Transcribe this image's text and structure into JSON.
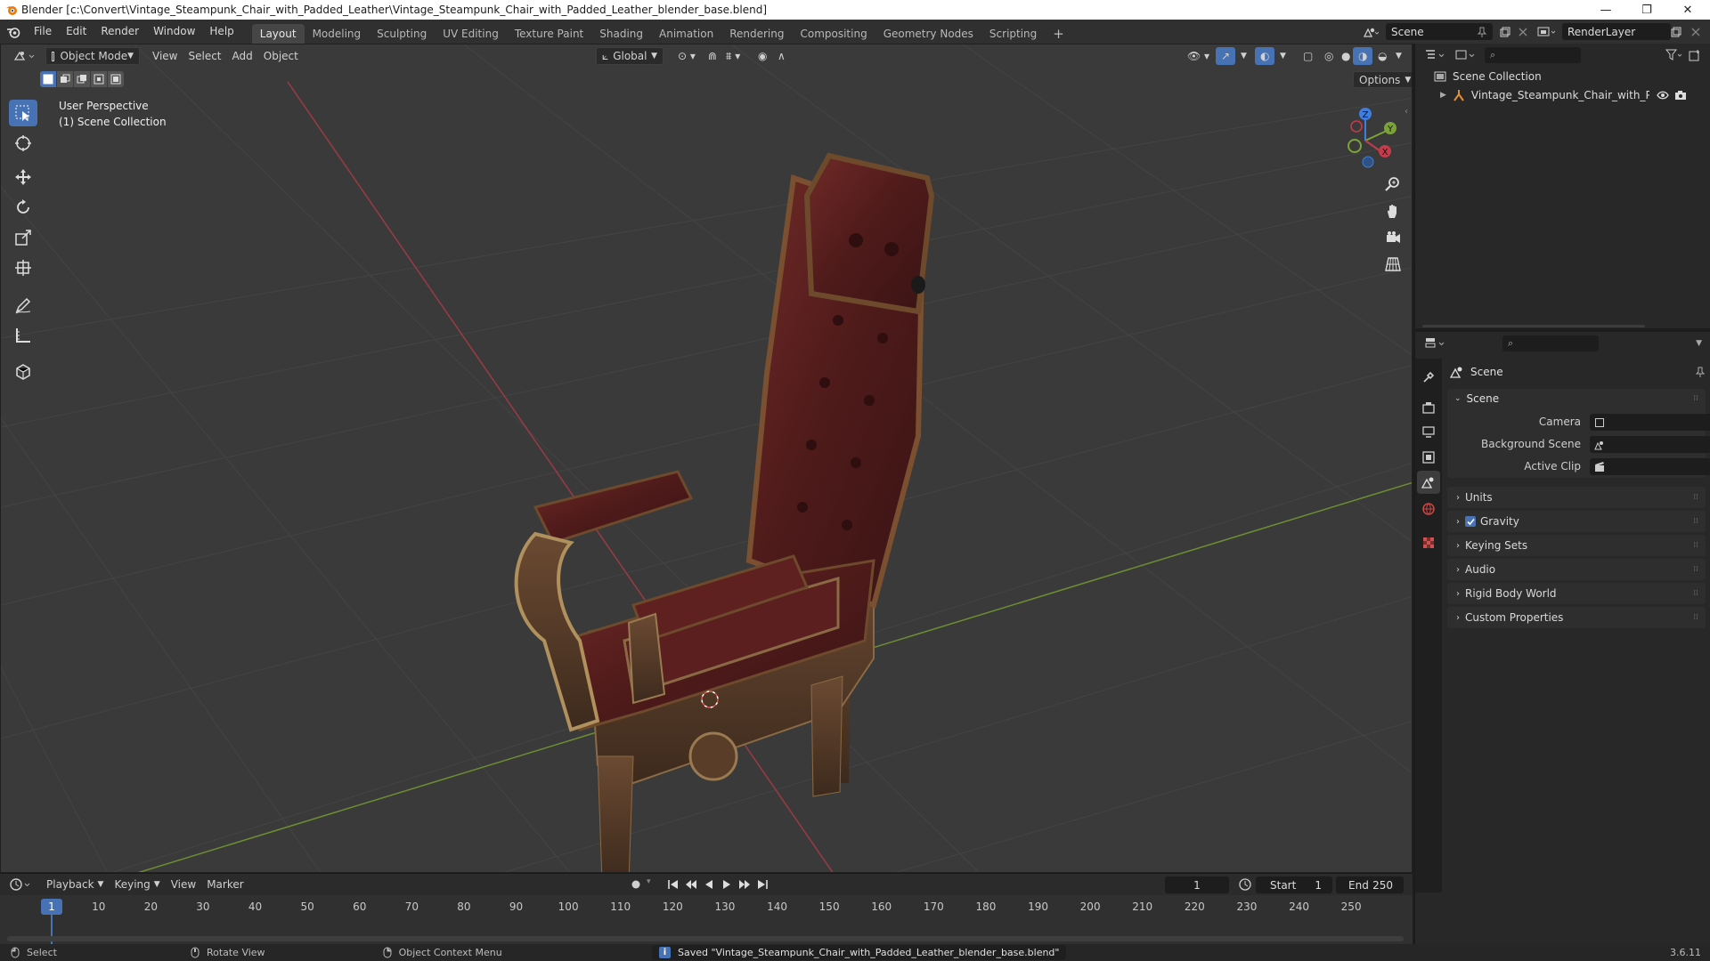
{
  "window": {
    "title": "Blender [c:\\Convert\\Vintage_Steampunk_Chair_with_Padded_Leather\\Vintage_Steampunk_Chair_with_Padded_Leather_blender_base.blend]",
    "minimize": "—",
    "maximize": "❐",
    "close": "✕"
  },
  "menu": [
    "File",
    "Edit",
    "Render",
    "Window",
    "Help"
  ],
  "workspaces": {
    "tabs": [
      "Layout",
      "Modeling",
      "Sculpting",
      "UV Editing",
      "Texture Paint",
      "Shading",
      "Animation",
      "Rendering",
      "Compositing",
      "Geometry Nodes",
      "Scripting"
    ],
    "active": "Layout",
    "add": "+"
  },
  "scene_selector": {
    "value": "Scene"
  },
  "view_layer_selector": {
    "value": "RenderLayer"
  },
  "viewport": {
    "mode": "Object Mode",
    "menus": [
      "View",
      "Select",
      "Add",
      "Object"
    ],
    "orientation": "Global",
    "options": "Options",
    "overlay_text": {
      "perspective": "User Perspective",
      "collection": "(1) Scene Collection"
    },
    "gizmo_axes": {
      "x": "X",
      "y": "Y",
      "z": "Z"
    }
  },
  "outliner": {
    "search_placeholder": "",
    "root": "Scene Collection",
    "items": [
      {
        "label": "Vintage_Steampunk_Chair_with_Paddec"
      }
    ]
  },
  "properties": {
    "header": "Scene",
    "scene_panel": {
      "title": "Scene",
      "fields": [
        {
          "label": "Camera",
          "value": ""
        },
        {
          "label": "Background Scene",
          "value": ""
        },
        {
          "label": "Active Clip",
          "value": ""
        }
      ]
    },
    "panels": [
      {
        "label": "Units",
        "checkbox": false
      },
      {
        "label": "Gravity",
        "checkbox": true
      },
      {
        "label": "Keying Sets",
        "checkbox": false
      },
      {
        "label": "Audio",
        "checkbox": false
      },
      {
        "label": "Rigid Body World",
        "checkbox": false
      },
      {
        "label": "Custom Properties",
        "checkbox": false
      }
    ]
  },
  "timeline": {
    "menus": [
      "Playback",
      "Keying",
      "View",
      "Marker"
    ],
    "current_frame": "1",
    "start_label": "Start",
    "start": "1",
    "end_label": "End",
    "end": "250",
    "ticks": [
      "1",
      "10",
      "20",
      "30",
      "40",
      "50",
      "60",
      "70",
      "80",
      "90",
      "100",
      "110",
      "120",
      "130",
      "140",
      "150",
      "160",
      "170",
      "180",
      "190",
      "200",
      "210",
      "220",
      "230",
      "240",
      "250"
    ]
  },
  "statusbar": {
    "select": "Select",
    "rotate": "Rotate View",
    "context": "Object Context Menu",
    "message": "Saved \"Vintage_Steampunk_Chair_with_Padded_Leather_blender_base.blend\"",
    "version": "3.6.11"
  },
  "colors": {
    "accent": "#4772b3",
    "x_axis": "#c43b4a",
    "y_axis": "#7ba33a",
    "z_axis": "#3e7ee0"
  }
}
